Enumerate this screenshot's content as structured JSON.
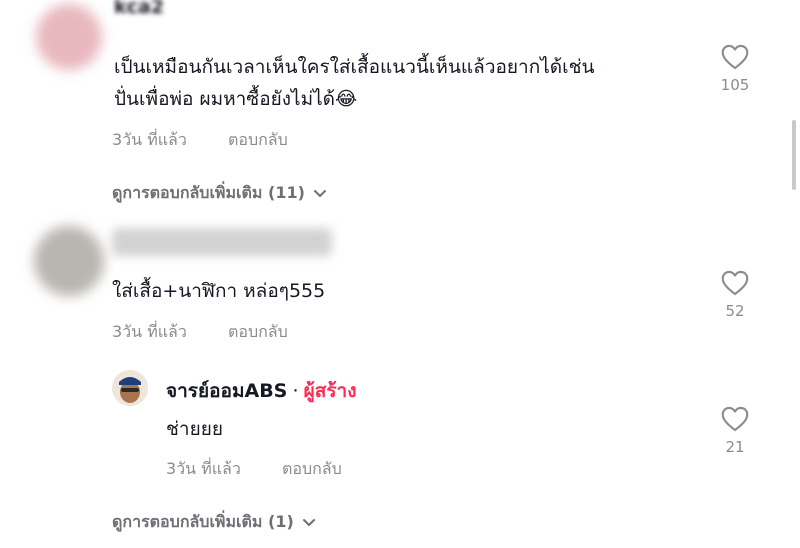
{
  "comments": [
    {
      "username": "kca2",
      "text_line1": "เป็นเหมือนกันเวลาเห็นใครใส่เสื้อแนวนี้เห็นแล้วอยากได้เช่น",
      "text_line2": "ปั่นเพื่อพ่อ ผมหาซื้อยังไม่ได้",
      "emoji": "😂",
      "time": "3วัน ที่แล้ว",
      "reply_label": "ตอบกลับ",
      "likes": "105",
      "view_replies": "ดูการตอบกลับเพิ่มเติม (11)"
    },
    {
      "username": "",
      "text": "ใส่เสื้อ+นาฬิกา หล่อๆ555",
      "time": "3วัน ที่แล้ว",
      "reply_label": "ตอบกลับ",
      "likes": "52",
      "reply": {
        "username": "จารย์ออมABS",
        "separator": "·",
        "creator_badge": "ผู้สร้าง",
        "text": "ช่ายยย",
        "time": "3วัน ที่แล้ว",
        "reply_label": "ตอบกลับ",
        "likes": "21"
      },
      "view_replies": "ดูการตอบกลับเพิ่มเติม (1)"
    }
  ],
  "colors": {
    "creator": "#fe2c55",
    "muted": "#8a8b91"
  },
  "icons": [
    "heart-outline-icon",
    "chevron-down-icon"
  ]
}
